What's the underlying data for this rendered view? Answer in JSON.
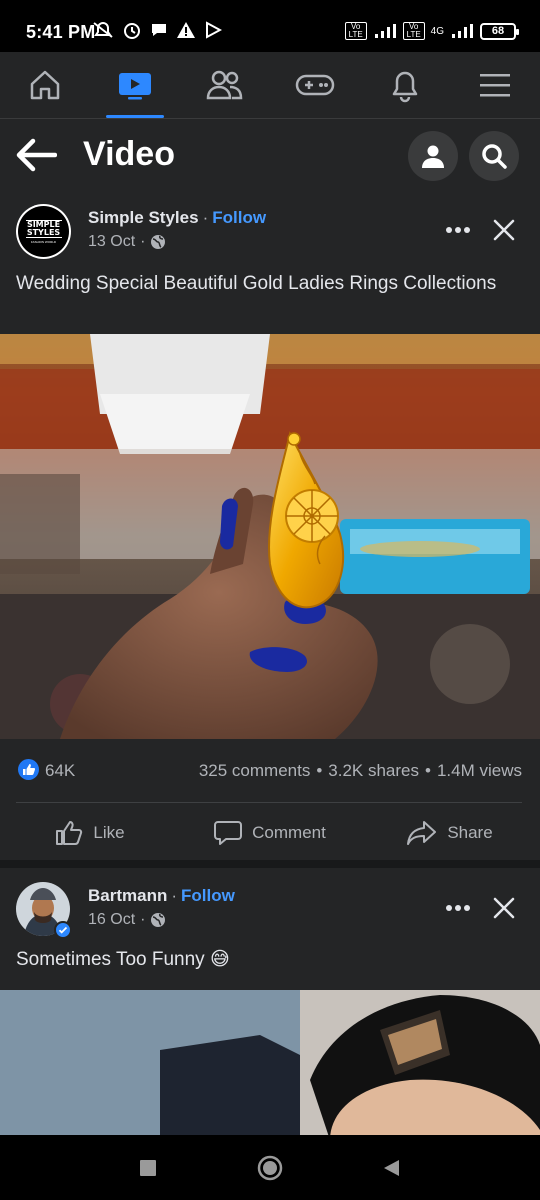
{
  "status_bar": {
    "time": "5:41 PM",
    "left_icons": [
      "muted-notification-icon",
      "alarm-icon",
      "chat-bubble-icon",
      "warning-icon",
      "play-store-icon"
    ],
    "network_label_1": "Vo LTE",
    "network_label_2": "Vo LTE",
    "network_type": "4G",
    "battery": "68"
  },
  "top_nav": {
    "tabs": [
      {
        "icon": "home-icon",
        "active": false
      },
      {
        "icon": "video-icon",
        "active": true
      },
      {
        "icon": "friends-icon",
        "active": false
      },
      {
        "icon": "gaming-icon",
        "active": false
      },
      {
        "icon": "bell-icon",
        "active": false
      },
      {
        "icon": "menu-icon",
        "active": false
      }
    ],
    "accent_color": "#2d88ff"
  },
  "header": {
    "title": "Video"
  },
  "posts": [
    {
      "author": "Simple Styles",
      "avatar_text": "SIMPLE STYLES",
      "avatar_subtext": "FASHION WORLD",
      "follow_label": "Follow",
      "date": "13 Oct",
      "caption": "Wedding Special Beautiful Gold Ladies Rings Collections",
      "likes": "64K",
      "comments": "325 comments",
      "shares": "3.2K shares",
      "views": "1.4M views",
      "actions": {
        "like": "Like",
        "comment": "Comment",
        "share": "Share"
      }
    },
    {
      "author": "Bartmann",
      "follow_label": "Follow",
      "date": "16 Oct",
      "caption": "Sometimes Too Funny 😅"
    }
  ],
  "colors": {
    "background": "#18191a",
    "card": "#242526",
    "follow": "#4599ff",
    "like_badge": "#2078f4"
  }
}
